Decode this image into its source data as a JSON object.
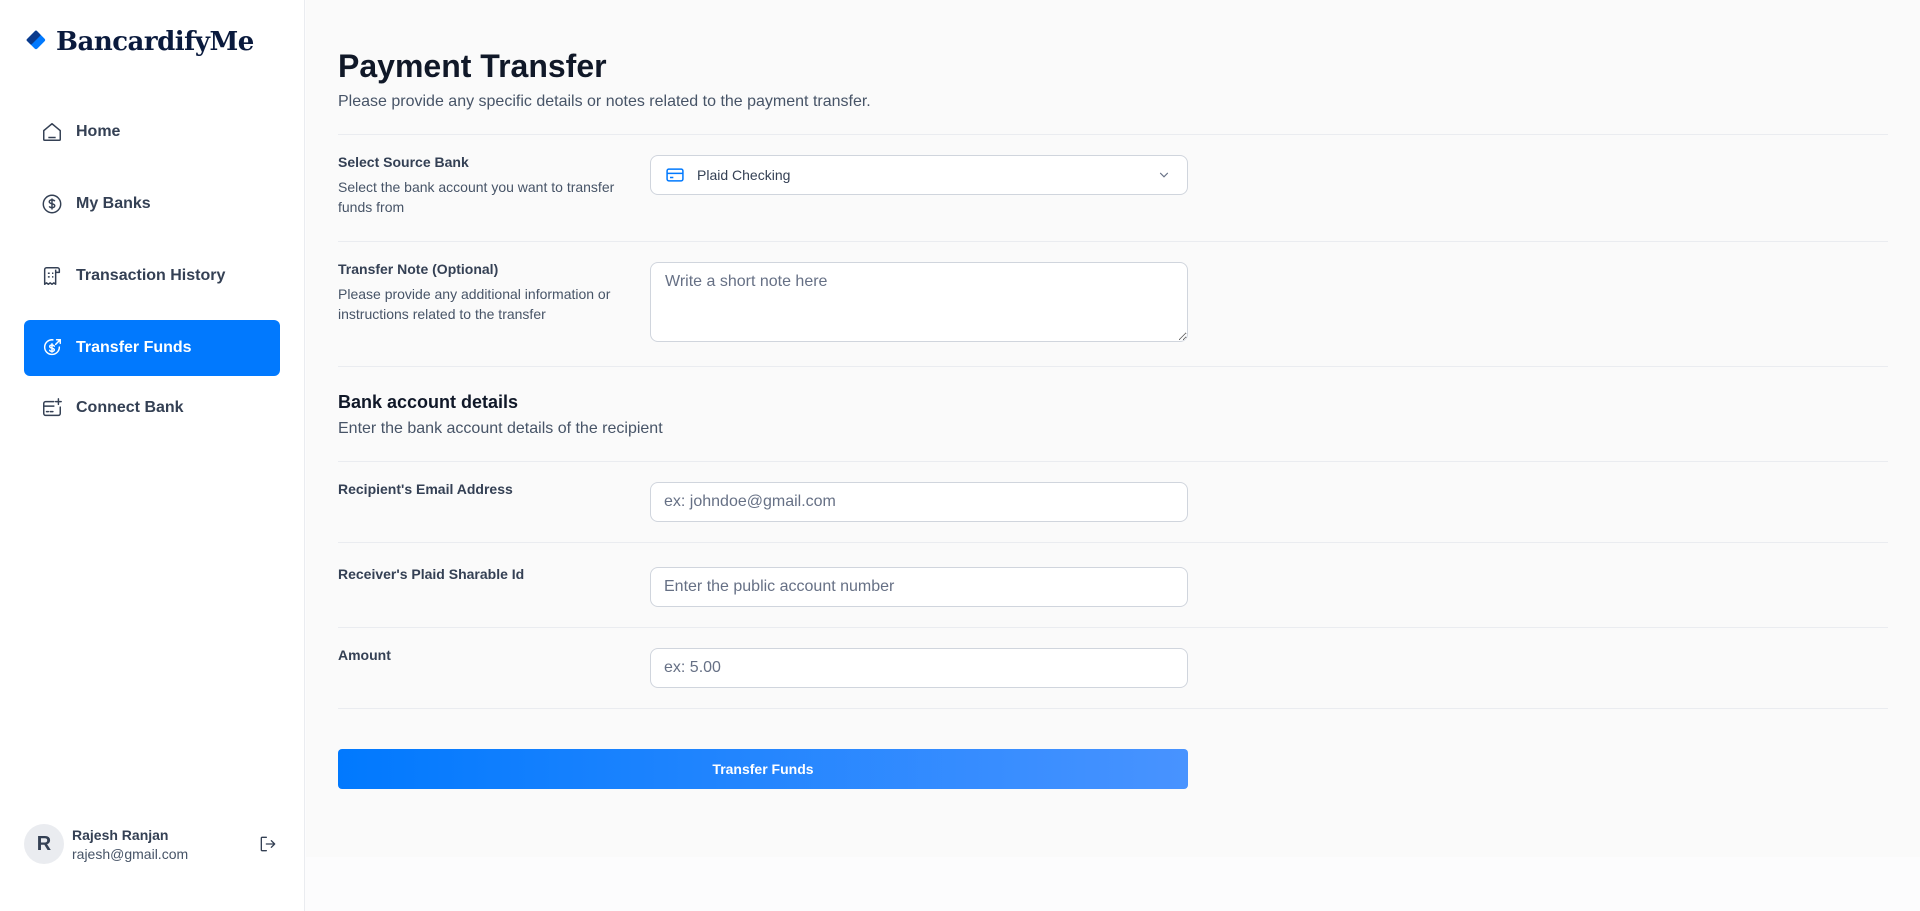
{
  "app": {
    "name": "BancardifyMe"
  },
  "sidebar": {
    "items": [
      {
        "label": "Home",
        "icon": "home-icon",
        "active": false
      },
      {
        "label": "My Banks",
        "icon": "dollar-circle-icon",
        "active": false
      },
      {
        "label": "Transaction History",
        "icon": "receipt-icon",
        "active": false
      },
      {
        "label": "Transfer Funds",
        "icon": "money-send-icon",
        "active": true
      },
      {
        "label": "Connect Bank",
        "icon": "card-add-icon",
        "active": false
      }
    ],
    "user": {
      "initial": "R",
      "name": "Rajesh Ranjan",
      "email": "rajesh@gmail.com"
    }
  },
  "page": {
    "title": "Payment Transfer",
    "subtitle": "Please provide any specific details or notes related to the payment transfer."
  },
  "form": {
    "source_bank": {
      "label": "Select Source Bank",
      "description": "Select the bank account you want to transfer funds from",
      "selected": "Plaid Checking"
    },
    "note": {
      "label": "Transfer Note (Optional)",
      "description": "Please provide any additional information or instructions related to the transfer",
      "placeholder": "Write a short note here"
    },
    "bank_details": {
      "title": "Bank account details",
      "subtitle": "Enter the bank account details of the recipient"
    },
    "email": {
      "label": "Recipient's Email Address",
      "placeholder": "ex: johndoe@gmail.com"
    },
    "sharable_id": {
      "label": "Receiver's Plaid Sharable Id",
      "placeholder": "Enter the public account number"
    },
    "amount": {
      "label": "Amount",
      "placeholder": "ex: 5.00"
    },
    "submit_label": "Transfer Funds"
  },
  "colors": {
    "accent": "#0179fe",
    "accent_light": "#4893ff",
    "text_dark": "#101828",
    "text_muted": "#475467"
  }
}
